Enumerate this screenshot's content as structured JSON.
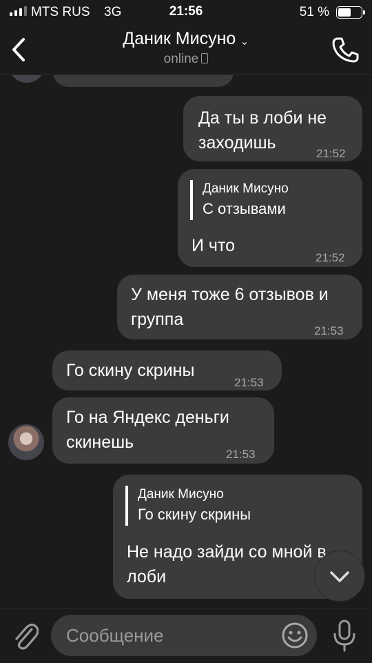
{
  "status": {
    "carrier": "MTS RUS",
    "network": "3G",
    "time": "21:56",
    "battery": "51 %"
  },
  "header": {
    "title": "Даник Мисуно",
    "subtitle": "online"
  },
  "messages": [
    {
      "text": "Да ты в лоби не заходишь",
      "time": "21:52"
    },
    {
      "reply_name": "Даник Мисуно",
      "reply_text": "С отзывами",
      "text": "И что",
      "time": "21:52"
    },
    {
      "text": "У меня тоже 6 отзывов и группа",
      "time": "21:53"
    },
    {
      "text": "Го скину скрины",
      "time": "21:53"
    },
    {
      "text": "Го на Яндекс деньги скинешь",
      "time": "21:53"
    },
    {
      "reply_name": "Даник Мисуно",
      "reply_text": "Го скину скрины",
      "text": "Не надо зайди со мной в лоби"
    }
  ],
  "composer": {
    "placeholder": "Сообщение"
  },
  "colors": {
    "background": "#1b1b1b",
    "bubble": "#3b3b3b",
    "time_text": "#a8a8a8"
  }
}
